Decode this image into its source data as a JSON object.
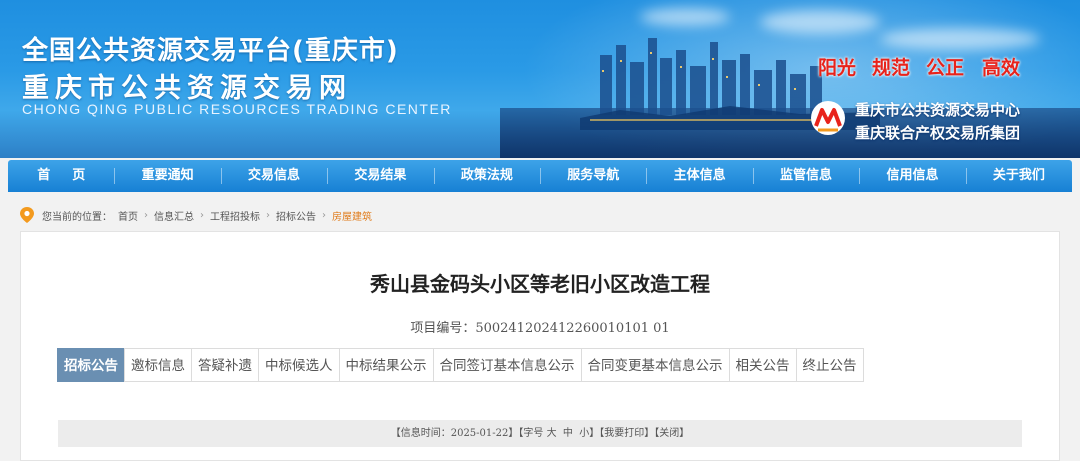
{
  "header": {
    "title_line1": "全国公共资源交易平台(重庆市)",
    "title_line2": "重庆市公共资源交易网",
    "title_en": "CHONG QING PUBLIC RESOURCES TRADING CENTER",
    "slogans": [
      "阳光",
      "规范",
      "公正",
      "高效"
    ],
    "org_line1": "重庆市公共资源交易中心",
    "org_line2": "重庆联合产权交易所集团",
    "colors": {
      "slogan": "#e8231b",
      "nav": "#1780d4"
    }
  },
  "nav": {
    "items": [
      "首页",
      "重要通知",
      "交易信息",
      "交易结果",
      "政策法规",
      "服务导航",
      "主体信息",
      "监管信息",
      "信用信息",
      "关于我们"
    ]
  },
  "breadcrumb": {
    "prefix": "您当前的位置：",
    "items": [
      "首页",
      "信息汇总",
      "工程招投标",
      "招标公告",
      "房屋建筑"
    ]
  },
  "article": {
    "title": "秀山县金码头小区等老旧小区改造工程",
    "project_no": "项目编号：500241202412260010101 01",
    "tabs": [
      "招标公告",
      "邀标信息",
      "答疑补遗",
      "中标候选人",
      "中标结果公示",
      "合同签订基本信息公示",
      "合同变更基本信息公示",
      "相关公告",
      "终止公告"
    ],
    "active_tab": "招标公告"
  },
  "info_bar": {
    "time": "【信息时间：2025-01-22】",
    "font_label": "【字号",
    "font_large": "大",
    "font_medium": "中",
    "font_small": "小】",
    "print": "【我要打印】",
    "close": "【关闭】"
  }
}
